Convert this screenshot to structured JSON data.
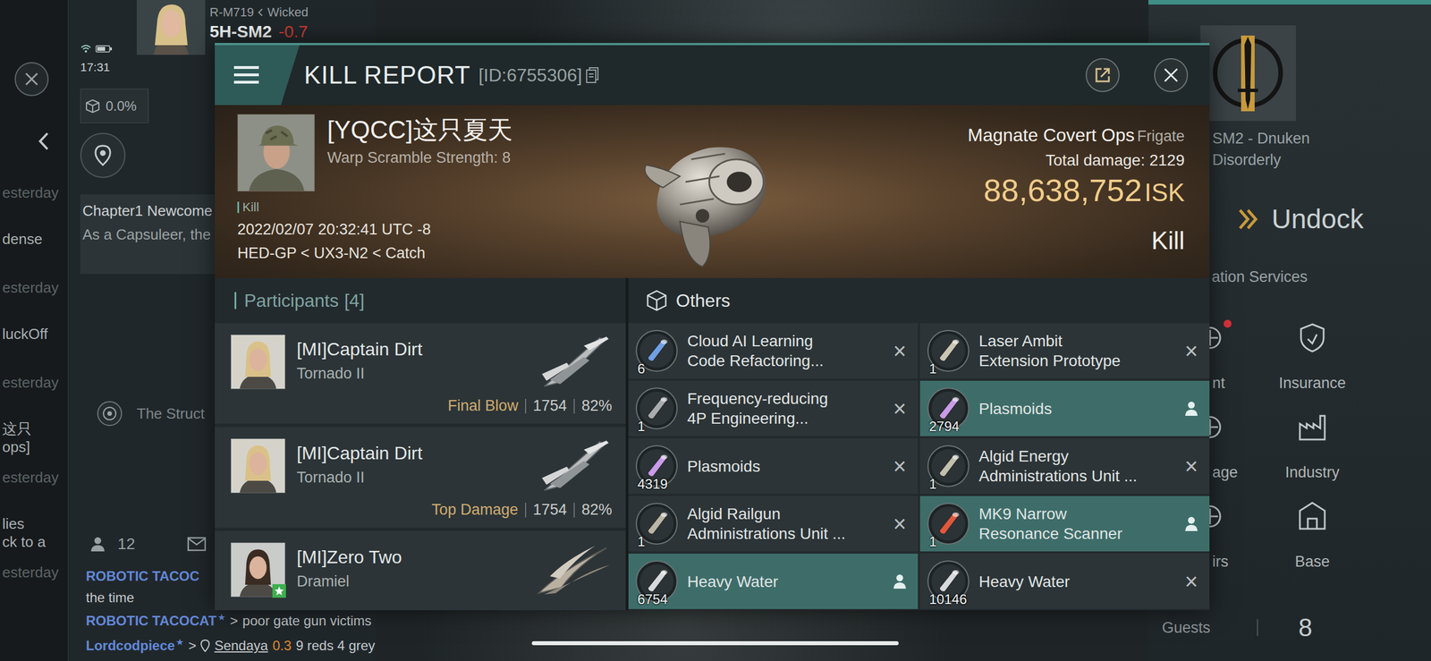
{
  "status_bar": {
    "time": "17:31",
    "cargo": "0.0%"
  },
  "location": {
    "route": "R-M719",
    "region": "Wicked",
    "system": "5H-SM2",
    "security": "-0.7"
  },
  "side_feed": [
    {
      "time": "esterday",
      "lines": [
        "dense"
      ]
    },
    {
      "time": "esterday",
      "lines": [
        "luckOff"
      ]
    },
    {
      "time": "esterday",
      "lines": [
        "这只",
        "ops]"
      ]
    },
    {
      "time": "esterday",
      "lines": [
        "lies",
        "ck to a"
      ]
    },
    {
      "time": "esterday",
      "lines": []
    }
  ],
  "mission": {
    "title": "Chapter1 Newcome",
    "text": "As a Capsuleer, the"
  },
  "structure": {
    "label": "The Struct"
  },
  "local": {
    "count": "12"
  },
  "chat": [
    {
      "kind": "cut",
      "sender": "ROBOTIC TACOC",
      "message": "the time"
    },
    {
      "kind": "text",
      "sender": "ROBOTIC TACOCAT",
      "star": "★",
      "sep": ">",
      "message": "poor gate gun victims"
    },
    {
      "kind": "location",
      "sender": "Lordcodpiece",
      "star": "★",
      "sep": ">",
      "place": "Sendaya",
      "security": "0.3",
      "message": "9 reds 4 grey"
    }
  ],
  "kill_report": {
    "title": "KILL REPORT",
    "id": "[ID:6755306]",
    "victim": {
      "name": "[YQCC]这只夏天",
      "scramble": "Warp Scramble Strength: 8",
      "tag": "Kill",
      "time": "2022/02/07 20:32:41 UTC -8",
      "location": "HED-GP < UX3-N2 < Catch"
    },
    "ship": {
      "name": "Magnate Covert Ops",
      "class": "Frigate",
      "damage_label": "Total damage:",
      "damage": "2129",
      "value": "88,638,752",
      "currency": "ISK",
      "result": "Kill"
    },
    "participants": {
      "label": "Participants",
      "count": "[4]",
      "rows": [
        {
          "name": "[MI]Captain Dirt",
          "ship": "Tornado II",
          "kind": "tornado",
          "star": false,
          "role": "Final Blow",
          "damage": "1754",
          "share": "82%"
        },
        {
          "name": "[MI]Captain Dirt",
          "ship": "Tornado II",
          "kind": "tornado",
          "star": false,
          "role": "Top Damage",
          "damage": "1754",
          "share": "82%"
        },
        {
          "name": "[MI]Zero Two",
          "ship": "Dramiel",
          "kind": "dramiel",
          "star": true
        }
      ]
    },
    "others": {
      "label": "Others",
      "items": [
        {
          "lines": [
            "Cloud AI Learning",
            "Code Refactoring..."
          ],
          "qty": "6",
          "dropped": false,
          "mark": "×"
        },
        {
          "lines": [
            "Laser Ambit",
            "Extension Prototype"
          ],
          "qty": "1",
          "dropped": false,
          "mark": "×"
        },
        {
          "lines": [
            "Frequency-reducing",
            "4P Engineering..."
          ],
          "qty": "1",
          "dropped": false,
          "mark": "×"
        },
        {
          "lines": [
            "Plasmoids"
          ],
          "qty": "2794",
          "dropped": true
        },
        {
          "lines": [
            "Plasmoids"
          ],
          "qty": "4319",
          "dropped": false,
          "mark": "×"
        },
        {
          "lines": [
            "Algid Energy",
            "Administrations Unit ..."
          ],
          "qty": "1",
          "dropped": false,
          "mark": "×"
        },
        {
          "lines": [
            "Algid Railgun",
            "Administrations Unit ..."
          ],
          "qty": "1",
          "dropped": false,
          "mark": "×"
        },
        {
          "lines": [
            "MK9 Narrow",
            "Resonance Scanner"
          ],
          "qty": "1",
          "dropped": true
        },
        {
          "lines": [
            "Heavy Water"
          ],
          "qty": "6754",
          "dropped": true
        },
        {
          "lines": [
            "Heavy Water"
          ],
          "qty": "10146",
          "dropped": false,
          "mark": "×"
        }
      ]
    }
  },
  "station": {
    "name": "SM2 - Dnuken",
    "corp": "Disorderly",
    "undock": "Undock",
    "section": "ation Services",
    "services": [
      {
        "label": "nt",
        "kind": "agent",
        "alert": true
      },
      {
        "label": "Insurance",
        "kind": "insurance",
        "alert": false
      },
      {
        "label": "age",
        "kind": "storage",
        "alert": false
      },
      {
        "label": "Industry",
        "kind": "industry",
        "alert": false
      },
      {
        "label": "irs",
        "kind": "repairs",
        "alert": false
      },
      {
        "label": "Base",
        "kind": "base",
        "alert": false
      }
    ],
    "guests_label": "Guests",
    "guests": "8"
  }
}
